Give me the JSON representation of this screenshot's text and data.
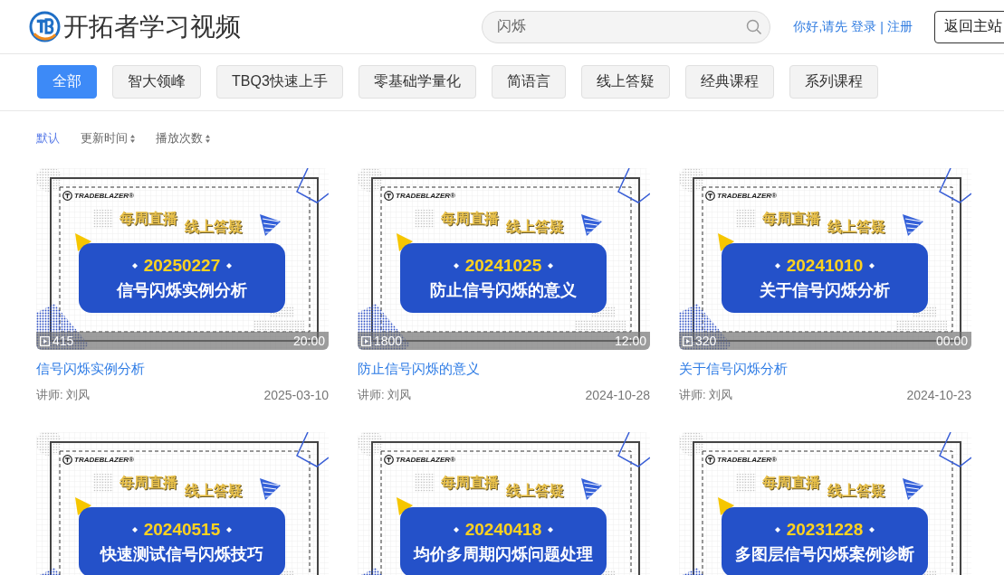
{
  "header": {
    "logo_text": "开拓者学习视频",
    "search": {
      "value": "闪烁"
    },
    "greeting": "你好,请先",
    "login": "登录",
    "separator": "|",
    "register": "注册",
    "home_button": "返回主站"
  },
  "categories": [
    {
      "label": "全部",
      "selected": true
    },
    {
      "label": "智大领峰",
      "selected": false
    },
    {
      "label": "TBQ3快速上手",
      "selected": false
    },
    {
      "label": "零基础学量化",
      "selected": false
    },
    {
      "label": "简语言",
      "selected": false
    },
    {
      "label": "线上答疑",
      "selected": false
    },
    {
      "label": "经典课程",
      "selected": false
    },
    {
      "label": "系列课程",
      "selected": false
    }
  ],
  "sort_options": [
    {
      "label": "默认",
      "selected": true,
      "sortable": false
    },
    {
      "label": "更新时间",
      "selected": false,
      "sortable": true
    },
    {
      "label": "播放次数",
      "selected": false,
      "sortable": true
    }
  ],
  "videos": [
    {
      "cover": {
        "brand": "TRADEBLAZER®",
        "tags": [
          "每周直播",
          "线上答疑"
        ],
        "date": "20250227",
        "headline": "信号闪烁实例分析"
      },
      "plays": "415",
      "duration": "20:00",
      "title": "信号闪烁实例分析",
      "teacher": "讲师: 刘风",
      "date": "2025-03-10"
    },
    {
      "cover": {
        "brand": "TRADEBLAZER®",
        "tags": [
          "每周直播",
          "线上答疑"
        ],
        "date": "20241025",
        "headline": "防止信号闪烁的意义"
      },
      "plays": "1800",
      "duration": "12:00",
      "title": "防止信号闪烁的意义",
      "teacher": "讲师: 刘风",
      "date": "2024-10-28"
    },
    {
      "cover": {
        "brand": "TRADEBLAZER®",
        "tags": [
          "每周直播",
          "线上答疑"
        ],
        "date": "20241010",
        "headline": "关于信号闪烁分析"
      },
      "plays": "320",
      "duration": "00:00",
      "title": "关于信号闪烁分析",
      "teacher": "讲师: 刘风",
      "date": "2024-10-23"
    },
    {
      "cover": {
        "brand": "TRADEBLAZER®",
        "tags": [
          "每周直播",
          "线上答疑"
        ],
        "date": "20240515",
        "headline": "快速测试信号闪烁技巧"
      }
    },
    {
      "cover": {
        "brand": "TRADEBLAZER®",
        "tags": [
          "每周直播",
          "线上答疑"
        ],
        "date": "20240418",
        "headline": "均价多周期闪烁问题处理"
      }
    },
    {
      "cover": {
        "brand": "TRADEBLAZER®",
        "tags": [
          "每周直播",
          "线上答疑"
        ],
        "date": "20231228",
        "headline": "多图层信号闪烁案例诊断"
      }
    }
  ]
}
